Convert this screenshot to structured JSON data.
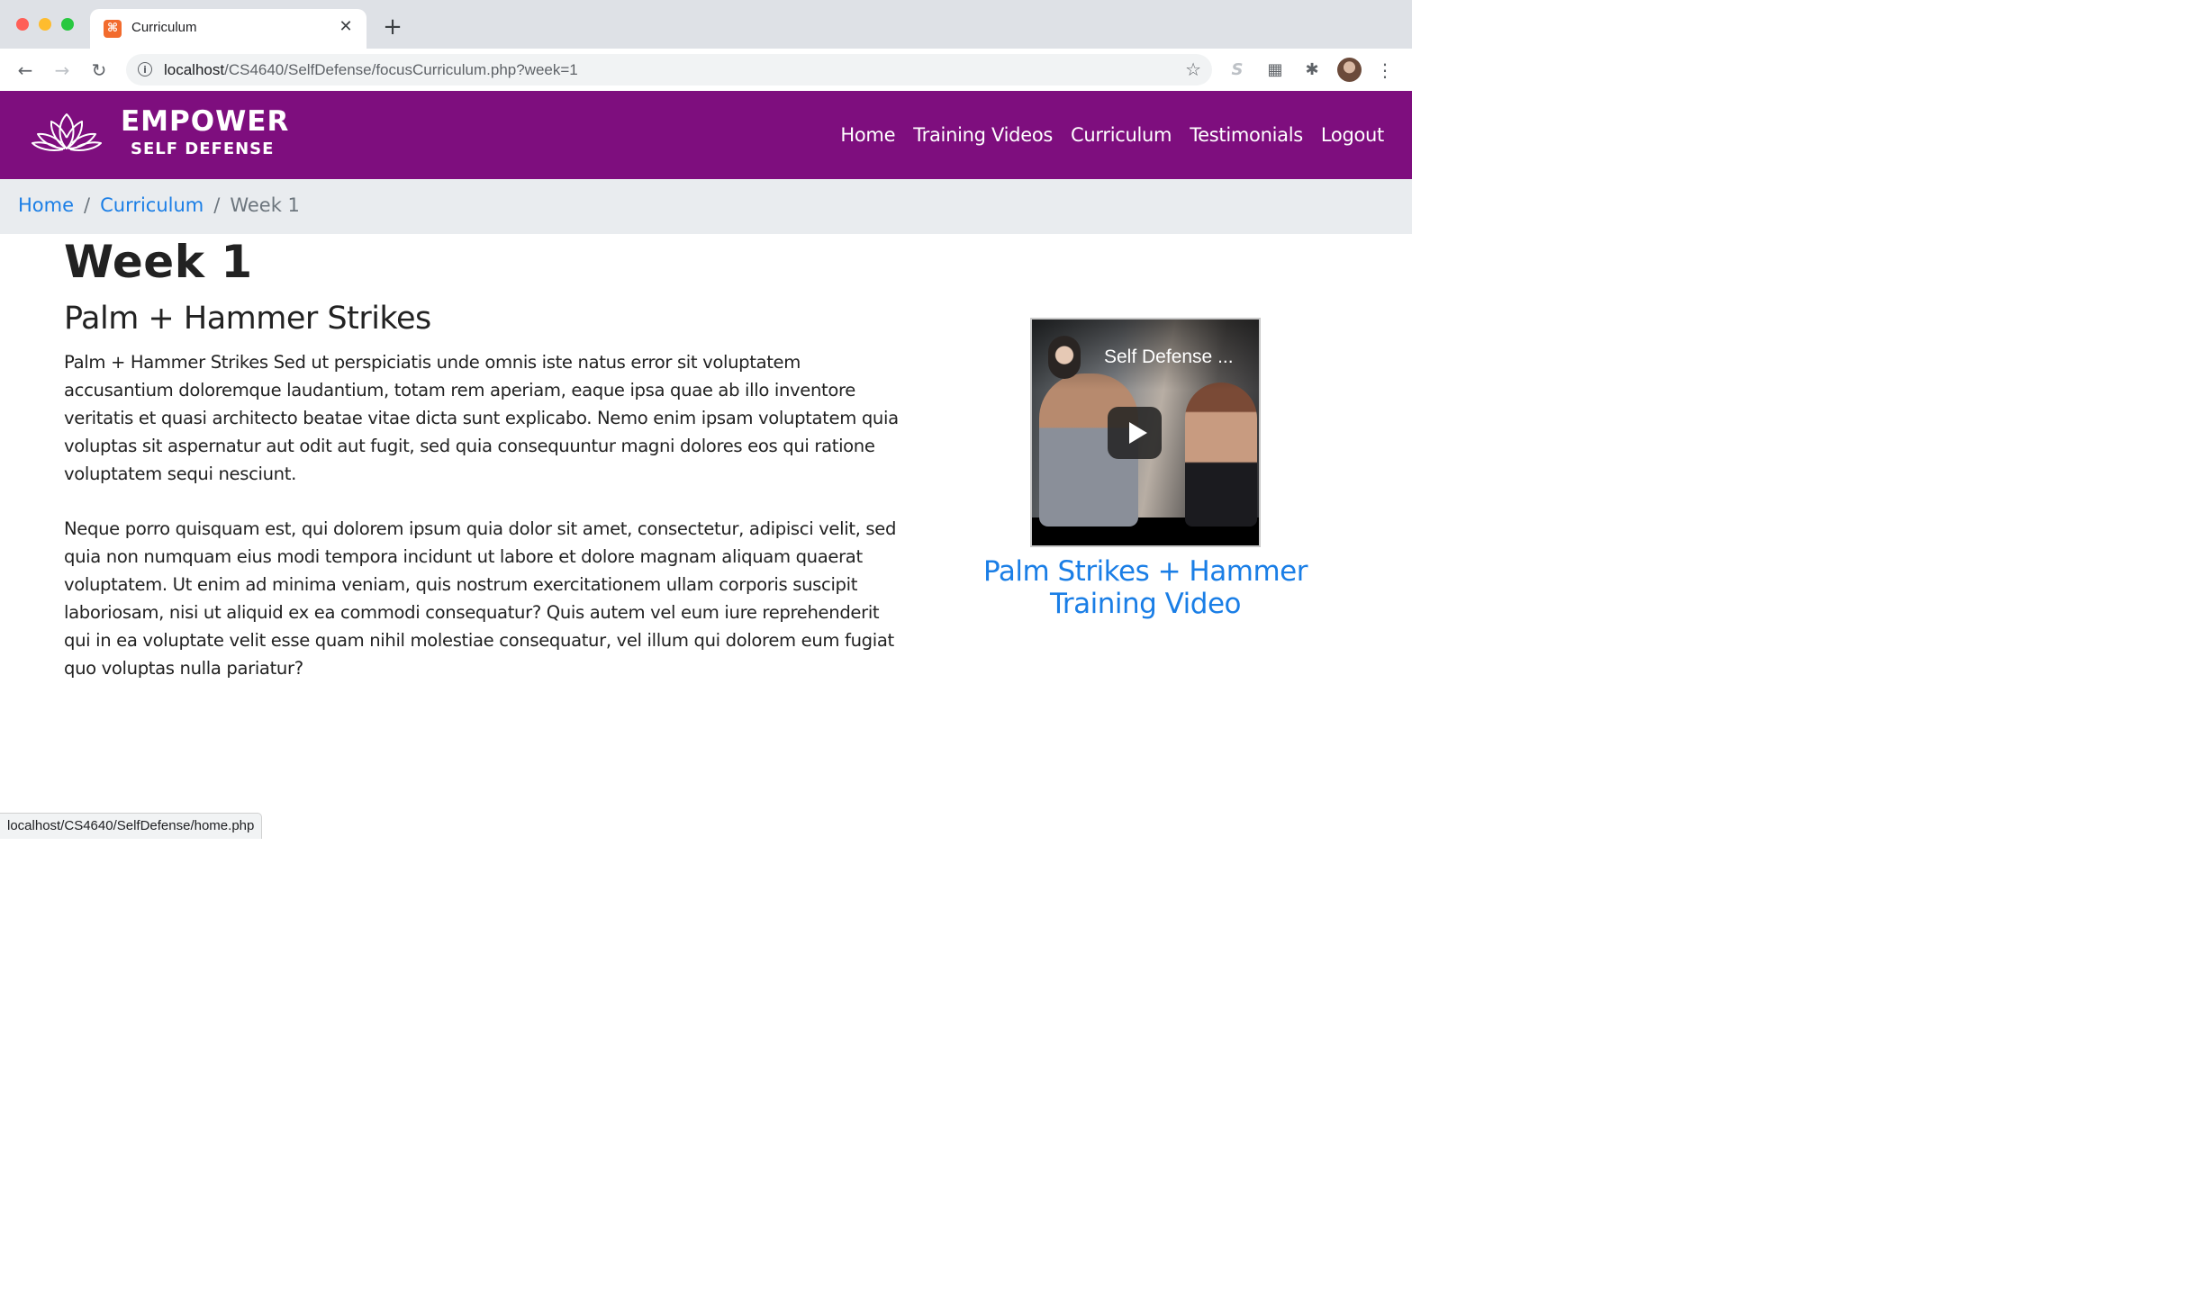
{
  "browser": {
    "tab_title": "Curriculum",
    "tab_favicon": "xampp-icon",
    "url_host": "localhost",
    "url_path": "/CS4640/SelfDefense/focusCurriculum.php?week=1",
    "status_url": "localhost/CS4640/SelfDefense/home.php"
  },
  "brand": {
    "name": "EMPOWER",
    "tagline": "SELF DEFENSE",
    "logo_icon": "lotus-icon",
    "color": "#7e0e7e"
  },
  "nav": {
    "items": [
      "Home",
      "Training Videos",
      "Curriculum",
      "Testimonials",
      "Logout"
    ]
  },
  "breadcrumb": {
    "items": [
      "Home",
      "Curriculum"
    ],
    "active": "Week 1",
    "separator": "/"
  },
  "content": {
    "week_title": "Week 1",
    "section_title": "Palm + Hammer Strikes",
    "paragraphs": [
      "Palm + Hammer Strikes Sed ut perspiciatis unde omnis iste natus error sit voluptatem accusantium doloremque laudantium, totam rem aperiam, eaque ipsa quae ab illo inventore veritatis et quasi architecto beatae vitae dicta sunt explicabo. Nemo enim ipsam voluptatem quia voluptas sit aspernatur aut odit aut fugit, sed quia consequuntur magni dolores eos qui ratione voluptatem sequi nesciunt.",
      "Neque porro quisquam est, qui dolorem ipsum quia dolor sit amet, consectetur, adipisci velit, sed quia non numquam eius modi tempora incidunt ut labore et dolore magnam aliquam quaerat voluptatem. Ut enim ad minima veniam, quis nostrum exercitationem ullam corporis suscipit laboriosam, nisi ut aliquid ex ea commodi consequatur? Quis autem vel eum iure reprehenderit qui in ea voluptate velit esse quam nihil molestiae consequatur, vel illum qui dolorem eum fugiat quo voluptas nulla pariatur?"
    ]
  },
  "video": {
    "overlay_title": "Self Defense ...",
    "caption": "Palm Strikes + Hammer Training Video",
    "link_color": "#1a7ee6"
  }
}
